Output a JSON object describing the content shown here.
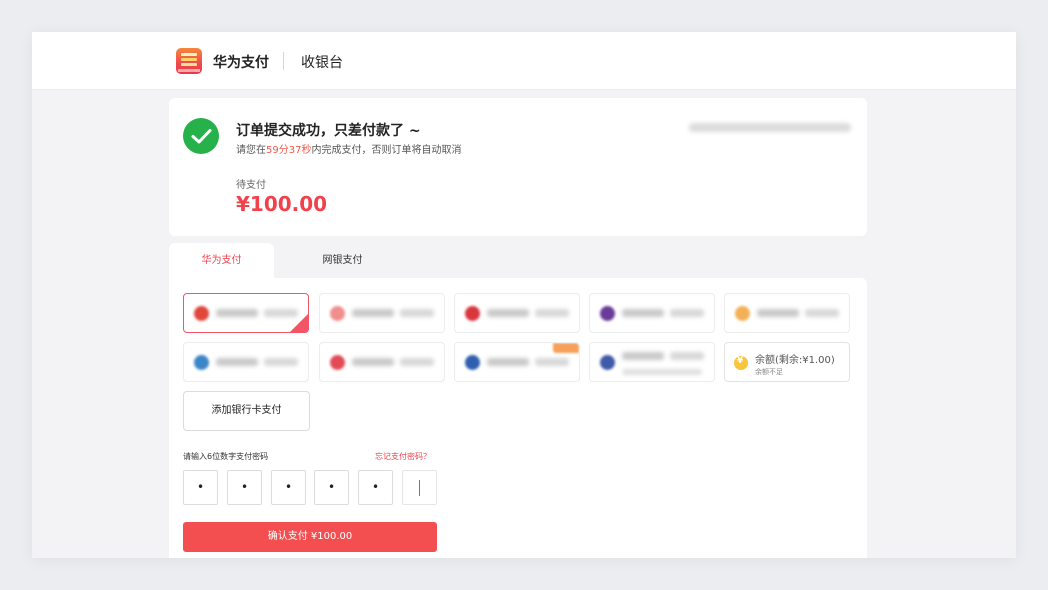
{
  "header": {
    "brand_name": "华为支付",
    "page_title": "收银台"
  },
  "order": {
    "success_title": "订单提交成功，只差付款了 ~",
    "hint_prefix": "请您在",
    "hint_countdown": "59分37秒",
    "hint_suffix": "内完成支付，否则订单将自动取消",
    "pending_label": "待支付",
    "amount": "¥100.00"
  },
  "tabs": [
    {
      "label": "华为支付",
      "active": true
    },
    {
      "label": "网银支付",
      "active": false
    }
  ],
  "bank_cards": [
    {
      "icon_color": "#e0463c",
      "selected": true
    },
    {
      "icon_color": "#f08e8e",
      "selected": false
    },
    {
      "icon_color": "#d9363e",
      "selected": false
    },
    {
      "icon_color": "#6b3b9a",
      "selected": false
    },
    {
      "icon_color": "#f3b057",
      "selected": false
    },
    {
      "icon_color": "#3b86c8",
      "selected": false
    },
    {
      "icon_color": "#e24b56",
      "selected": false
    },
    {
      "icon_color": "#2f5fb0",
      "selected": false,
      "badge": true
    },
    {
      "icon_color": "#3e5aa8",
      "selected": false,
      "subline": true
    }
  ],
  "balance": {
    "main": "余额(剩余:¥1.00)",
    "sub": "余额不足"
  },
  "add_card_label": "添加银行卡支付",
  "password": {
    "label": "请输入6位数字支付密码",
    "forgot": "忘记支付密码？",
    "digits": [
      "•",
      "•",
      "•",
      "•",
      "•",
      ""
    ]
  },
  "confirm_button": "确认支付 ¥100.00",
  "colors": {
    "accent_red": "#f0414c",
    "success_green": "#27b14a"
  }
}
